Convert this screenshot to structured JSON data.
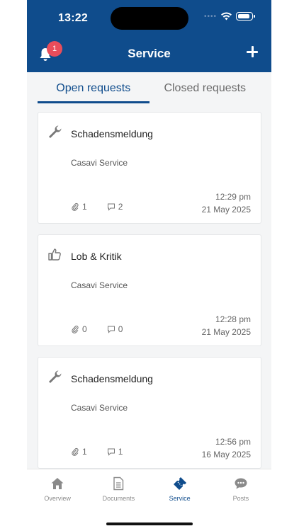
{
  "status_bar": {
    "time": "13:22"
  },
  "header": {
    "title": "Service",
    "notification_count": "1"
  },
  "tabs": [
    {
      "label": "Open requests",
      "active": true
    },
    {
      "label": "Closed requests",
      "active": false
    }
  ],
  "requests": [
    {
      "icon": "wrench-icon",
      "title": "Schadensmeldung",
      "subtitle": "Casavi Service",
      "attachments": "1",
      "comments": "2",
      "time": "12:29 pm",
      "date": "21 May 2025"
    },
    {
      "icon": "thumbs-up-icon",
      "title": "Lob & Kritik",
      "subtitle": "Casavi Service",
      "attachments": "0",
      "comments": "0",
      "time": "12:28 pm",
      "date": "21 May 2025"
    },
    {
      "icon": "wrench-icon",
      "title": "Schadensmeldung",
      "subtitle": "Casavi Service",
      "attachments": "1",
      "comments": "1",
      "time": "12:56 pm",
      "date": "16 May 2025"
    }
  ],
  "bottom_nav": [
    {
      "label": "Overview",
      "icon": "home-icon"
    },
    {
      "label": "Documents",
      "icon": "document-icon"
    },
    {
      "label": "Service",
      "icon": "ticket-icon",
      "active": true
    },
    {
      "label": "Posts",
      "icon": "chat-bubble-icon"
    }
  ],
  "colors": {
    "primary": "#0f4c8c",
    "badge": "#e84d5b",
    "background": "#f4f5f6"
  }
}
